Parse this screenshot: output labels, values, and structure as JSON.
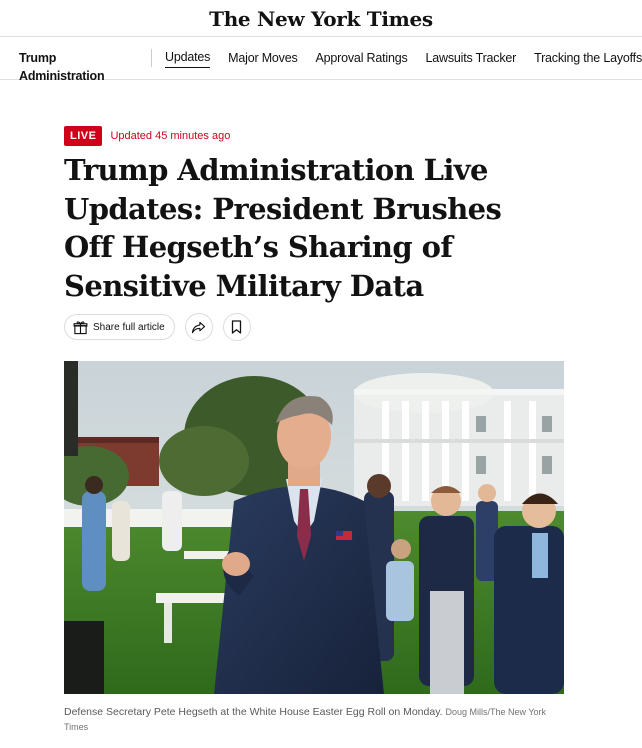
{
  "masthead": {
    "logo": "The New York Times"
  },
  "nav": {
    "section": "Trump Administration",
    "links": [
      "Updates",
      "Major Moves",
      "Approval Ratings",
      "Lawsuits Tracker",
      "Tracking the Layoffs"
    ],
    "active_index": 0
  },
  "article": {
    "live_label": "LIVE",
    "updated": "Updated 45 minutes ago",
    "headline": "Trump Administration Live Updates: President Brushes Off Hegseth’s Sharing of Sensitive Military Data",
    "share_label": "Share full article",
    "share_icon": "gift-icon",
    "forward_icon": "share-arrow-icon",
    "save_icon": "bookmark-icon",
    "caption": "Defense Secretary Pete Hegseth at the White House Easter Egg Roll on Monday.",
    "credit": "Doug Mills/The New York Times"
  },
  "colors": {
    "live_red": "#d0021b",
    "text": "#121212",
    "caption": "#5a5a5a"
  }
}
